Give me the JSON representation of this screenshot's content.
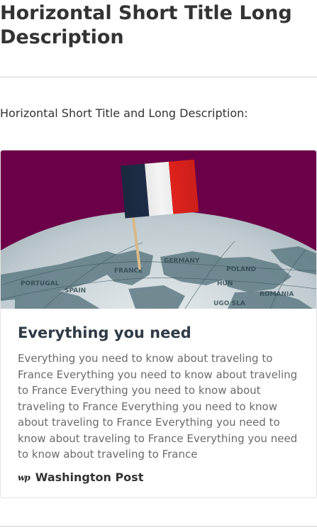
{
  "page": {
    "title": "Horizontal Short Title Long Description"
  },
  "section": {
    "label": "Horizontal Short Title and Long Description:"
  },
  "card": {
    "title": "Everything you need",
    "description": "Everything you need to know about traveling to France Everything you need to know about traveling to France Everything you need to know about traveling to France Everything you need to know about traveling to France Everything you need to know about traveling to France Everything you need to know about traveling to France",
    "source": {
      "logo_text": "wp",
      "name": "Washington Post"
    },
    "image": {
      "map_labels": [
        "GERMANY",
        "POLAND",
        "FRANCE",
        "SPAIN",
        "ROMANIA",
        "PORTUGAL",
        "HUN",
        "UGO SLA"
      ]
    }
  },
  "colors": {
    "image_background": "#6b0048",
    "flag_blue": "#1f2f4a",
    "flag_white": "#f4f4f4",
    "flag_red": "#e8231e",
    "title_text": "#2f3b45",
    "body_text": "#6b6b6b"
  }
}
